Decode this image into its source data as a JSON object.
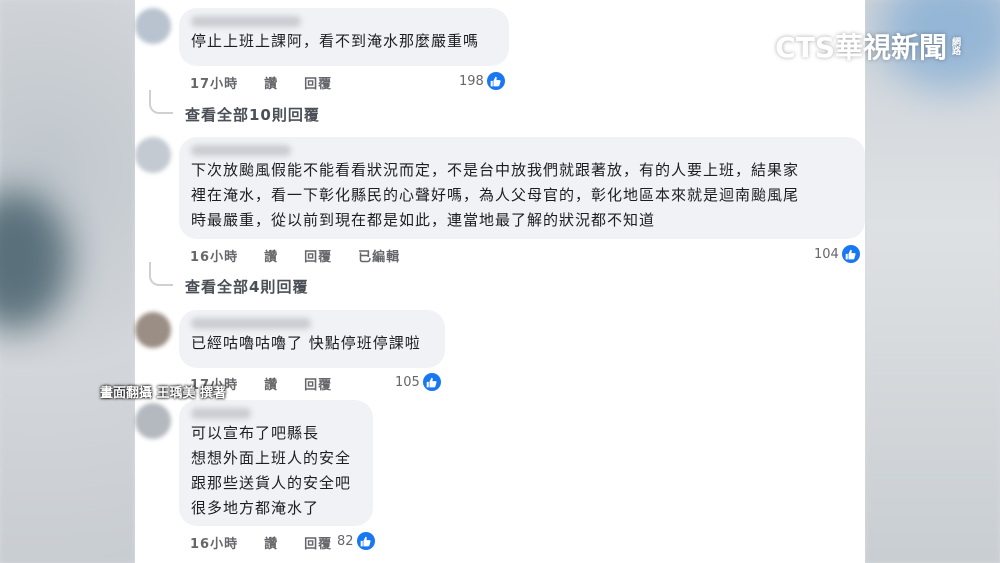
{
  "logo": {
    "main": "CTS華視新聞",
    "sub": "網路"
  },
  "credit": "畫面翻攝 王瑀美 撰著",
  "comments": [
    {
      "text": "停止上班上課阿，看不到淹水那麼嚴重嗎",
      "time": "17小時",
      "like_action": "讚",
      "reply_action": "回覆",
      "edited": "",
      "likes": "198",
      "view_replies": "查看全部10則回覆"
    },
    {
      "text": "下次放颱風假能不能看看狀況而定，不是台中放我們就跟著放，有的人要上班，結果家\n裡在淹水，看一下彰化縣民的心聲好嗎，為人父母官的，彰化地區本來就是迴南颱風尾\n時最嚴重，從以前到現在都是如此，連當地最了解的狀況都不知道",
      "time": "16小時",
      "like_action": "讚",
      "reply_action": "回覆",
      "edited": "已編輯",
      "likes": "104",
      "view_replies": "查看全部4則回覆"
    },
    {
      "text": "已經咕嚕咕嚕了 快點停班停課啦",
      "time": "17小時",
      "like_action": "讚",
      "reply_action": "回覆",
      "edited": "",
      "likes": "105",
      "view_replies": ""
    },
    {
      "text": "可以宣布了吧縣長\n想想外面上班人的安全\n跟那些送貨人的安全吧\n很多地方都淹水了",
      "time": "16小時",
      "like_action": "讚",
      "reply_action": "回覆",
      "edited": "",
      "likes": "82",
      "view_replies": ""
    }
  ],
  "colors": {
    "like_blue": "#1877f2",
    "bubble_bg": "#f0f2f5",
    "meta_gray": "#65676b"
  }
}
